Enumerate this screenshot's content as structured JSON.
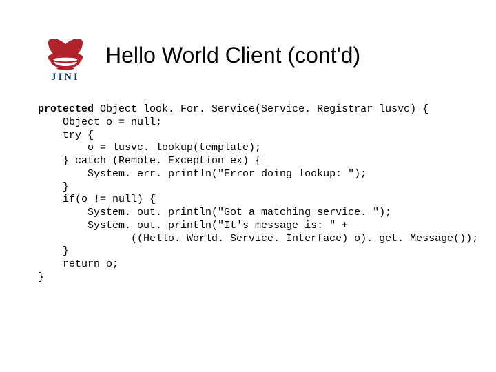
{
  "title": "Hello World Client (cont'd)",
  "code": {
    "l1a": "protected",
    "l1b": " Object look. For. Service(Service. Registrar lusvc) {",
    "l2": "    Object o = null;",
    "l3": "    try {",
    "l4": "        o = lusvc. lookup(template);",
    "l5": "    } catch (Remote. Exception ex) {",
    "l6": "        System. err. println(\"Error doing lookup: \");",
    "l7": "    }",
    "l8": "    if(o != null) {",
    "l9": "        System. out. println(\"Got a matching service. \");",
    "l10": "        System. out. println(\"It's message is: \" +",
    "l11": "               ((Hello. World. Service. Interface) o). get. Message());",
    "l12": "    }",
    "l13": "    return o;",
    "l14": "}"
  }
}
